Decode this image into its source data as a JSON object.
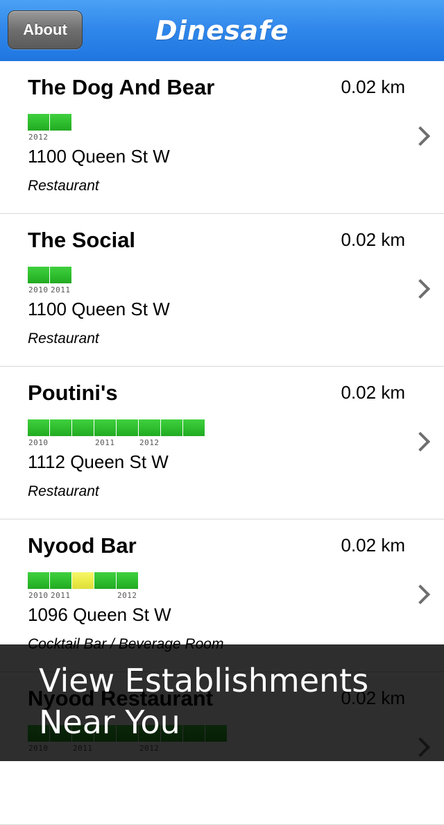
{
  "navbar": {
    "about_label": "About",
    "title": "Dinesafe",
    "color": "#2f86ea"
  },
  "establishments": [
    {
      "name": "The Dog And Bear",
      "distance": "0.02 km",
      "address": "1100 Queen St W",
      "category": "Restaurant",
      "inspections": [
        "green",
        "green"
      ],
      "years": [
        {
          "label": "2012",
          "index": 0
        }
      ]
    },
    {
      "name": "The Social",
      "distance": "0.02 km",
      "address": "1100 Queen St W",
      "category": "Restaurant",
      "inspections": [
        "green",
        "green"
      ],
      "years": [
        {
          "label": "2010",
          "index": 0
        },
        {
          "label": "2011",
          "index": 1
        }
      ]
    },
    {
      "name": "Poutini's",
      "distance": "0.02 km",
      "address": "1112 Queen St W",
      "category": "Restaurant",
      "inspections": [
        "green",
        "green",
        "green",
        "green",
        "green",
        "green",
        "green",
        "green"
      ],
      "years": [
        {
          "label": "2010",
          "index": 0
        },
        {
          "label": "2011",
          "index": 3
        },
        {
          "label": "2012",
          "index": 5
        }
      ]
    },
    {
      "name": "Nyood Bar",
      "distance": "0.02 km",
      "address": "1096 Queen St W",
      "category": "Cocktail Bar / Beverage Room",
      "inspections": [
        "green",
        "green",
        "yellow",
        "green",
        "green"
      ],
      "years": [
        {
          "label": "2010",
          "index": 0
        },
        {
          "label": "2011",
          "index": 1
        },
        {
          "label": "2012",
          "index": 4
        }
      ]
    },
    {
      "name": "Nyood Restaurant",
      "distance": "0.02 km",
      "address": "",
      "category": "",
      "inspections": [
        "green",
        "green",
        "green",
        "green",
        "green",
        "green",
        "green",
        "green",
        "green"
      ],
      "years": [
        {
          "label": "2010",
          "index": 0
        },
        {
          "label": "2011",
          "index": 2
        },
        {
          "label": "2012",
          "index": 5
        }
      ]
    }
  ],
  "overlay": {
    "text": "View Establishments Near You"
  },
  "colors": {
    "pass": "#2fbf2f",
    "conditional": "#ecec4a",
    "chevron": "#6e6e6e"
  },
  "icons": {
    "row_disclosure": "chevron-right-icon"
  }
}
